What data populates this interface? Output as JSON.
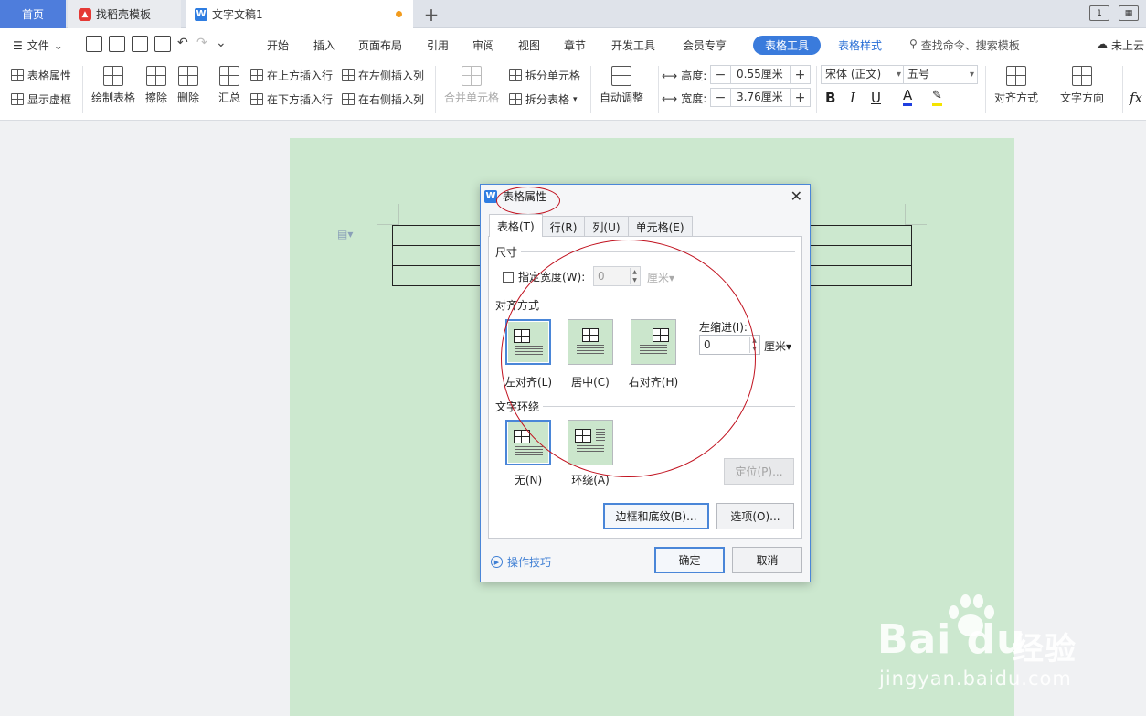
{
  "tabs": {
    "home": "首页",
    "template": "找稻壳模板",
    "document": "文字文稿1",
    "add": "+"
  },
  "window": {
    "restore_label": "1"
  },
  "menu": {
    "file": "文件",
    "items": [
      "开始",
      "插入",
      "页面布局",
      "引用",
      "审阅",
      "视图",
      "章节",
      "开发工具",
      "会员专享"
    ],
    "active": "表格工具",
    "table_style": "表格样式",
    "search": "查找命令、搜索模板",
    "cloud": "未上云"
  },
  "ribbon": {
    "table_props": "表格属性",
    "show_grid": "显示虚框",
    "draw_table": "绘制表格",
    "erase": "擦除",
    "delete": "删除",
    "summary": "汇总",
    "insert_above": "在上方插入行",
    "insert_below": "在下方插入行",
    "insert_left": "在左侧插入列",
    "insert_right": "在右侧插入列",
    "merge": "合并单元格",
    "split_cell": "拆分单元格",
    "split_table": "拆分表格",
    "auto_fit": "自动调整",
    "height_label": "高度:",
    "height_value": "0.55厘米",
    "width_label": "宽度:",
    "width_value": "3.76厘米",
    "font": "宋体 (正文)",
    "size": "五号",
    "bold": "B",
    "italic": "I",
    "underline": "U",
    "font_color": "A",
    "align": "对齐方式",
    "text_dir": "文字方向",
    "formula": "fx",
    "minus": "−",
    "plus": "+"
  },
  "dialog": {
    "title": "表格属性",
    "close": "✕",
    "tabs": [
      "表格(T)",
      "行(R)",
      "列(U)",
      "单元格(E)"
    ],
    "size_group": "尺寸",
    "specify_width": "指定宽度(W):",
    "width_value": "0",
    "width_unit": "厘米",
    "align_group": "对齐方式",
    "align_options": [
      "左对齐(L)",
      "居中(C)",
      "右对齐(H)"
    ],
    "indent_label": "左缩进(I):",
    "indent_value": "0",
    "indent_unit": "厘米",
    "wrap_group": "文字环绕",
    "wrap_options": [
      "无(N)",
      "环绕(A)"
    ],
    "position_btn": "定位(P)...",
    "borders_btn": "边框和底纹(B)...",
    "options_btn": "选项(O)...",
    "tips": "操作技巧",
    "ok": "确定",
    "cancel": "取消"
  },
  "watermark": {
    "logo": "Bai  du",
    "brand": "经验",
    "url": "jingyan.baidu.com"
  },
  "colors": {
    "accent": "#3a7bdc",
    "page_bg": "#cce8cf",
    "annotation": "#c1121f"
  }
}
